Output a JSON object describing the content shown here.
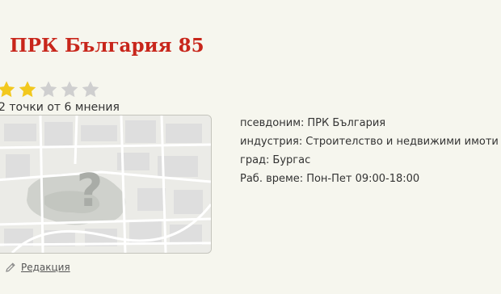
{
  "business": {
    "name": "ПРК България 85"
  },
  "rating": {
    "stars_filled": 2,
    "stars_total": 5,
    "summary": "2 точки от 6 мнения"
  },
  "map": {
    "icon": "question-mark-icon"
  },
  "details": [
    {
      "label": "псевдоним:",
      "value": "ПРК България"
    },
    {
      "label": "индустрия:",
      "value": "Строителство и недвижими имоти"
    },
    {
      "label": "град:",
      "value": "Бургас"
    },
    {
      "label": "Раб. време:",
      "value": "Пон-Пет 09:00-18:00"
    }
  ],
  "actions": {
    "edit_label": "Редакция",
    "edit_icon": "pencil-icon"
  },
  "colors": {
    "title": "#c8261b",
    "star_filled": "#f2c81e",
    "star_empty": "#cfcfcf",
    "background": "#f6f6ee"
  }
}
